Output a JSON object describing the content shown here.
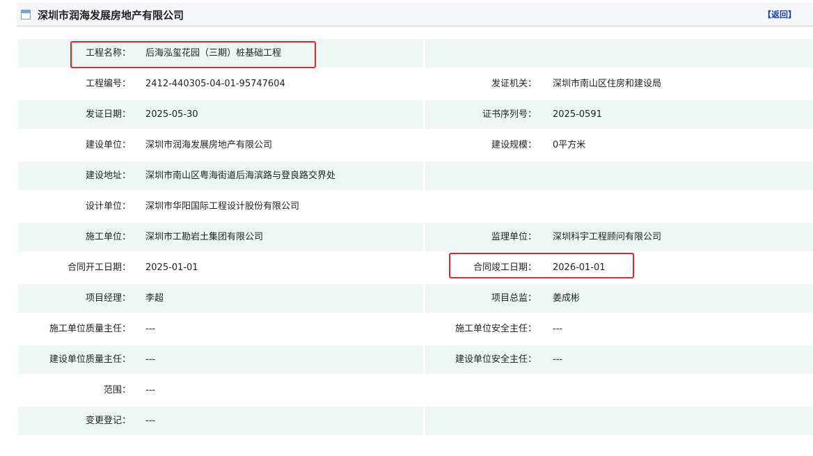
{
  "header": {
    "title": "深圳市润海发展房地产有限公司",
    "back_label": "【返回】"
  },
  "accent_colors": {
    "highlight": "#d9292f",
    "link": "#1d3fb2",
    "row_alt": "#eef6f3"
  },
  "fields": {
    "project_name_label": "工程名称：",
    "project_name": "后海泓玺花园（三期）桩基础工程",
    "project_no_label": "工程编号：",
    "project_no": "2412-440305-04-01-95747604",
    "issuer_label": "发证机关：",
    "issuer": "深圳市南山区住房和建设局",
    "issue_date_label": "发证日期：",
    "issue_date": "2025-05-30",
    "cert_serial_label": "证书序列号：",
    "cert_serial": "2025-0591",
    "builder_label": "建设单位：",
    "builder": "深圳市润海发展房地产有限公司",
    "scale_label": "建设规模：",
    "scale": "0平方米",
    "address_label": "建设地址：",
    "address": "深圳市南山区粤海街道后海滨路与登良路交界处",
    "designer_label": "设计单位：",
    "designer": "深圳市华阳国际工程设计股份有限公司",
    "contractor_label": "施工单位：",
    "contractor": "深圳市工勘岩土集团有限公司",
    "supervisor_label": "监理单位：",
    "supervisor": "深圳科宇工程顾问有限公司",
    "start_date_label": "合同开工日期：",
    "start_date": "2025-01-01",
    "finish_date_label": "合同竣工日期：",
    "finish_date": "2026-01-01",
    "pm_label": "项目经理：",
    "pm": "李超",
    "chief_label": "项目总监：",
    "chief": "姜成彬",
    "contractor_quality_label": "施工单位质量主任：",
    "contractor_quality": "---",
    "contractor_safety_label": "施工单位安全主任：",
    "contractor_safety": "---",
    "builder_quality_label": "建设单位质量主任：",
    "builder_quality": "---",
    "builder_safety_label": "建设单位安全主任：",
    "builder_safety": "---",
    "scope_label": "范围：",
    "scope": "---",
    "change_label": "变更登记：",
    "change": "---"
  }
}
